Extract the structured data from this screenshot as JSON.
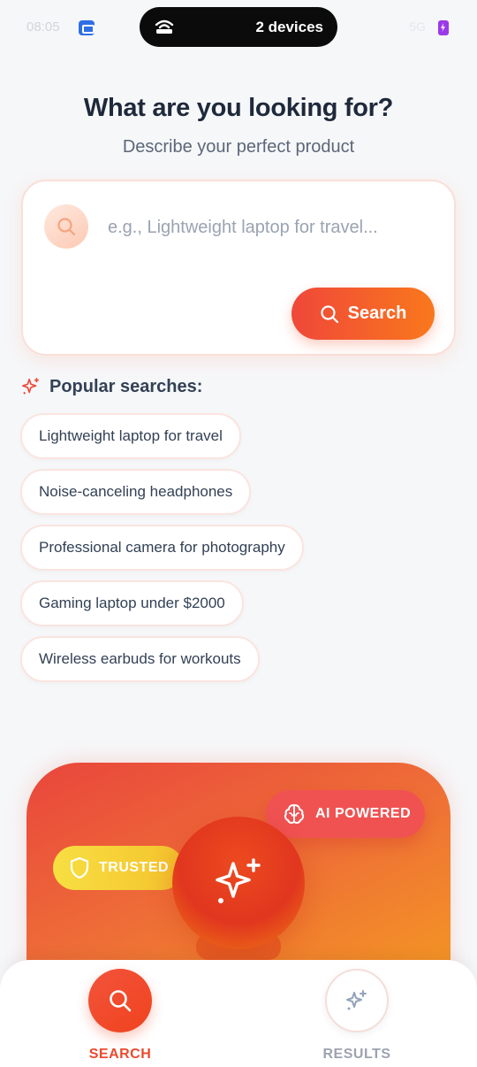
{
  "status_bar": {
    "time": "08:05",
    "devices_label": "2 devices",
    "right_text": "5G"
  },
  "header": {
    "title": "What are you looking for?",
    "subtitle": "Describe your perfect product"
  },
  "search": {
    "placeholder": "e.g., Lightweight laptop for travel...",
    "value": "",
    "button_label": "Search"
  },
  "popular": {
    "heading": "Popular searches:",
    "items": [
      {
        "label": "Lightweight laptop for travel"
      },
      {
        "label": "Noise-canceling headphones"
      },
      {
        "label": "Professional camera for photography"
      },
      {
        "label": "Gaming laptop under $2000"
      },
      {
        "label": "Wireless earbuds for workouts"
      }
    ]
  },
  "hero": {
    "badge_ai": "AI POWERED",
    "badge_trusted": "TRUSTED",
    "icon": "sparkles-icon"
  },
  "bottom_nav": {
    "search_label": "SEARCH",
    "results_label": "RESULTS",
    "active": "search"
  },
  "colors": {
    "accent": "#f0473a",
    "accent_end": "#f9781c",
    "badge_ai": "#f05252",
    "badge_trusted": "#f4c22d",
    "background": "#f6f7f9"
  }
}
